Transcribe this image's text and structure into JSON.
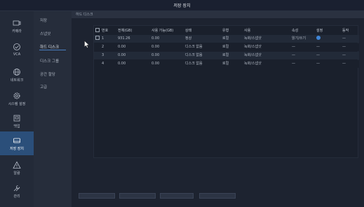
{
  "title": "저장 장치",
  "nav": [
    {
      "label": "카메라",
      "icon": "camera-icon"
    },
    {
      "label": "VCA",
      "icon": "vca-icon"
    },
    {
      "label": "네트워크",
      "icon": "globe-icon"
    },
    {
      "label": "시스템 설정",
      "icon": "settings-icon"
    },
    {
      "label": "백업",
      "icon": "backup-icon"
    },
    {
      "label": "저장 장치",
      "icon": "storage-icon",
      "active": true
    },
    {
      "label": "알람",
      "icon": "alarm-icon"
    },
    {
      "label": "관리",
      "icon": "tools-icon"
    }
  ],
  "subnav": [
    {
      "label": "저장"
    },
    {
      "label": "스냅샷"
    },
    {
      "label": "하드 디스크",
      "active": true
    },
    {
      "label": "디스크 그룹"
    },
    {
      "label": "공간 할당"
    },
    {
      "label": "고급"
    }
  ],
  "breadcrumb": "하드 디스크",
  "table": {
    "headers": [
      "번호",
      "전체(GB)",
      "사용 가능(GB)",
      "상태",
      "유형",
      "사용",
      "속성",
      "설정",
      "동작"
    ],
    "rows": [
      {
        "no": "1",
        "total": "931.26",
        "free": "0.00",
        "state": "정상",
        "type": "로컬",
        "use": "녹화/스냅샷",
        "attr": "읽기/쓰기",
        "setting": "gear",
        "action": "—"
      },
      {
        "no": "2",
        "total": "0.00",
        "free": "0.00",
        "state": "디스크 없음",
        "type": "로컬",
        "use": "녹화/스냅샷",
        "attr": "—",
        "setting": "—",
        "action": "—"
      },
      {
        "no": "3",
        "total": "0.00",
        "free": "0.00",
        "state": "디스크 없음",
        "type": "로컬",
        "use": "녹화/스냅샷",
        "attr": "—",
        "setting": "—",
        "action": "—"
      },
      {
        "no": "4",
        "total": "0.00",
        "free": "0.00",
        "state": "디스크 없음",
        "type": "로컬",
        "use": "녹화/스냅샷",
        "attr": "—",
        "setting": "—",
        "action": "—"
      }
    ]
  },
  "colors": {
    "accent": "#3f86d8",
    "active_nav": "#2b4f7a"
  }
}
